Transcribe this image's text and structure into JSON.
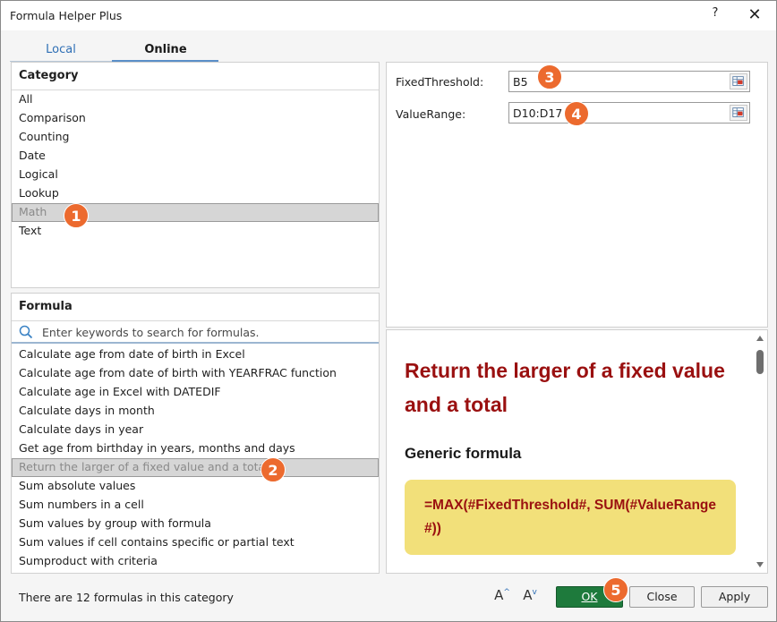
{
  "window": {
    "title": "Formula Helper Plus",
    "help_label": "?",
    "close_label": "✕"
  },
  "tabs": [
    {
      "label": "Local",
      "active": false
    },
    {
      "label": "Online",
      "active": true
    }
  ],
  "category": {
    "header": "Category",
    "items": [
      "All",
      "Comparison",
      "Counting",
      "Date",
      "Logical",
      "Lookup",
      "Math",
      "Text"
    ],
    "selected": "Math"
  },
  "formula": {
    "header": "Formula",
    "search_placeholder": "Enter keywords to search for formulas.",
    "items": [
      "Calculate age from date of birth in Excel",
      "Calculate age from date of birth with YEARFRAC function",
      "Calculate age in Excel with DATEDIF",
      "Calculate days in month",
      "Calculate days in year",
      "Get age from birthday in years, months and days",
      "Return the larger of a fixed value and a total",
      "Sum absolute values",
      "Sum numbers in a cell",
      "Sum values by group with formula",
      "Sum values if cell contains specific or partial text",
      "Sumproduct with criteria"
    ],
    "selected": "Return the larger of a fixed value and a total"
  },
  "params": [
    {
      "label": "FixedThreshold:",
      "value": "B5"
    },
    {
      "label": "ValueRange:",
      "value": "D10:D17"
    }
  ],
  "description": {
    "title": "Return the larger of a fixed value and a total",
    "subtitle": "Generic formula",
    "formula": "=MAX(#FixedThreshold#, SUM(#ValueRange#))"
  },
  "footer": {
    "status": "There are 12 formulas in this category",
    "increase_font": "A",
    "decrease_font": "A",
    "ok": "OK",
    "close": "Close",
    "apply": "Apply"
  },
  "callouts": [
    "1",
    "2",
    "3",
    "4",
    "5"
  ],
  "colors": {
    "accent_title": "#9a1010",
    "formula_bg": "#f2e07a",
    "ok_button": "#1e7a3c",
    "callout": "#ec6a2e"
  }
}
